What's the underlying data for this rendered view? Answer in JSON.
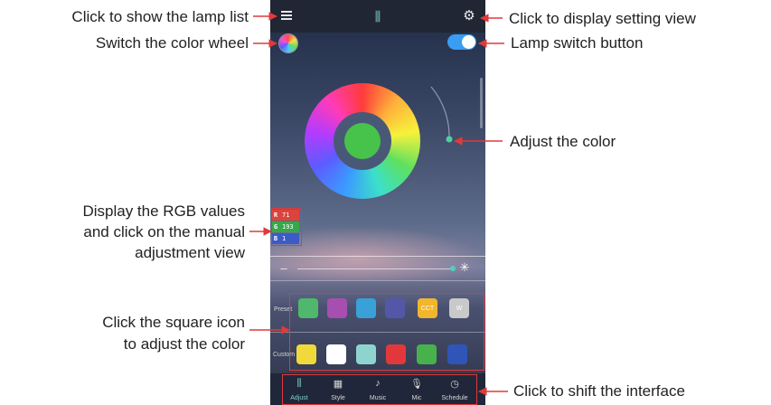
{
  "annotations": {
    "lamp_list": "Click to show the lamp list",
    "color_wheel_switch": "Switch the color wheel",
    "settings": "Click to display setting view",
    "lamp_switch": "Lamp switch button",
    "adjust_color": "Adjust the color",
    "rgb_line1": "Display the RGB values",
    "rgb_line2": "and click on the manual",
    "rgb_line3": "adjustment view",
    "square_line1": "Click the square icon",
    "square_line2": "to adjust the color",
    "shift_interface": "Click to shift the interface"
  },
  "rgb": {
    "r_key": "R",
    "r_value": "71",
    "g_key": "G",
    "g_value": "193",
    "b_key": "B",
    "b_value": "1"
  },
  "rows": {
    "first": "Preset",
    "second": "Custom"
  },
  "presets": {
    "cct_label": "CCT",
    "w_label": "W"
  },
  "nav": {
    "adjust": "Adjust",
    "style": "Style",
    "music": "Music",
    "mic": "Mic",
    "schedule": "Schedule"
  },
  "colors": {
    "accent": "#7fd0c8",
    "annotation_red": "#e03a3a",
    "switch_blue": "#3a9cf2",
    "wheel_center": "#47c24b",
    "preset_squares": [
      "#4fb86c",
      "#a74fb0",
      "#3aa1d8",
      "#5457a8",
      "#f2b52e",
      "#c9c9c9"
    ],
    "custom_squares": [
      "#f0d93a",
      "#ffffff",
      "#8fd3cf",
      "#e2383c",
      "#47b24b",
      "#2f55b8"
    ]
  },
  "icons": [
    "menu-icon",
    "adjust-icon",
    "gear-icon",
    "color-wheel-icon",
    "minus-icon",
    "sun-icon",
    "style-icon",
    "music-icon",
    "mic-icon",
    "schedule-icon"
  ]
}
